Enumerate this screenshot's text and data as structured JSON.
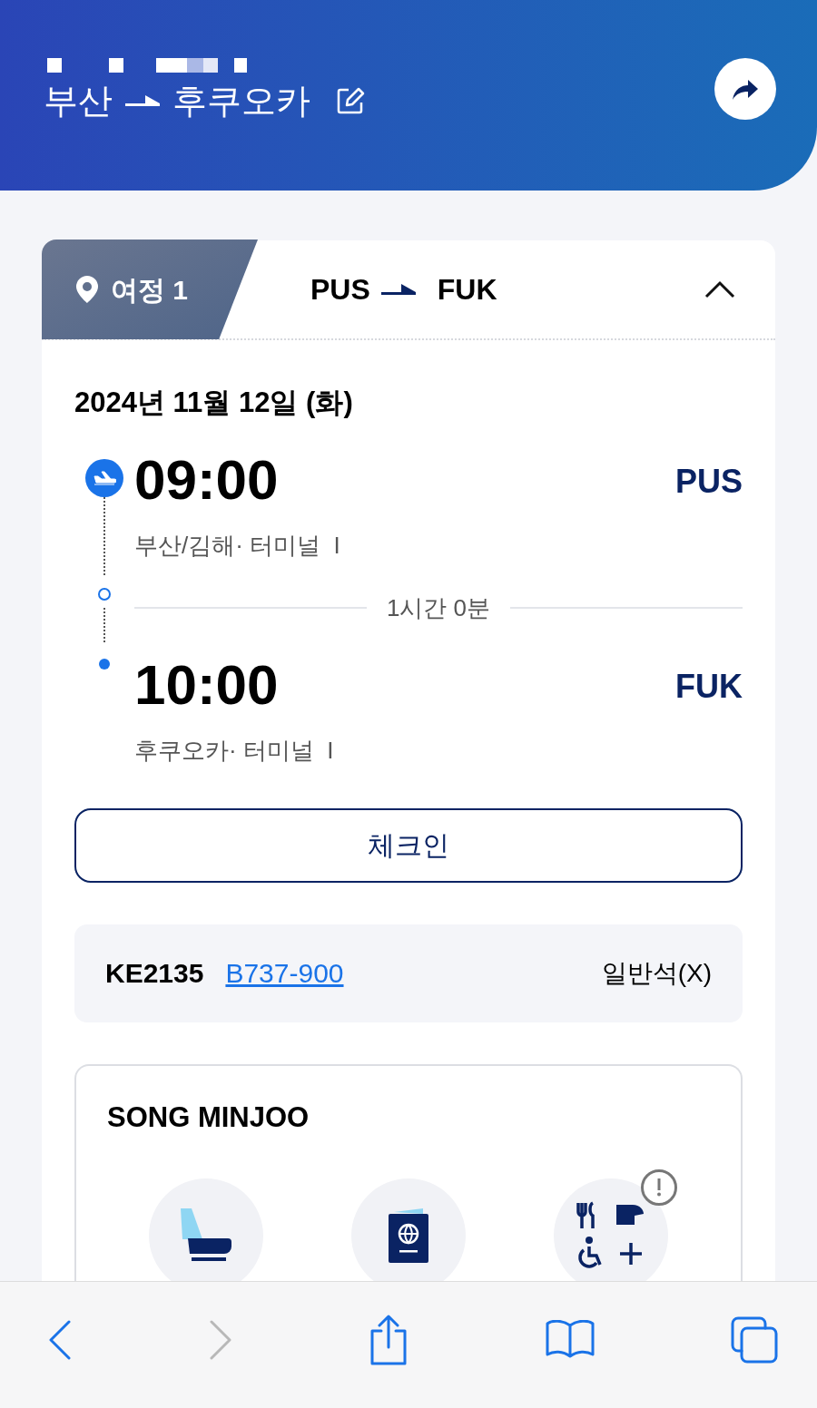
{
  "header": {
    "origin": "부산",
    "destination": "후쿠오카"
  },
  "segment": {
    "label": "여정 1",
    "from": "PUS",
    "to": "FUK",
    "expanded": true
  },
  "date": "2024년 11월 12일 (화)",
  "departure": {
    "time": "09:00",
    "code": "PUS",
    "terminal": "부산/김해· 터미널  I"
  },
  "duration": "1시간 0분",
  "arrival": {
    "time": "10:00",
    "code": "FUK",
    "terminal": "후쿠오카· 터미널  I"
  },
  "checkin_button": "체크인",
  "flight": {
    "number": "KE2135",
    "aircraft": "B737-900",
    "cabin": "일반석(X)"
  },
  "passenger": {
    "name": "SONG MINJOO",
    "alert": true
  },
  "toolbar": [
    {
      "kind": "back",
      "disabled": false
    },
    {
      "kind": "forward",
      "disabled": true
    },
    {
      "kind": "share",
      "disabled": false
    },
    {
      "kind": "bookmarks",
      "disabled": false
    },
    {
      "kind": "tabs",
      "disabled": false
    }
  ]
}
